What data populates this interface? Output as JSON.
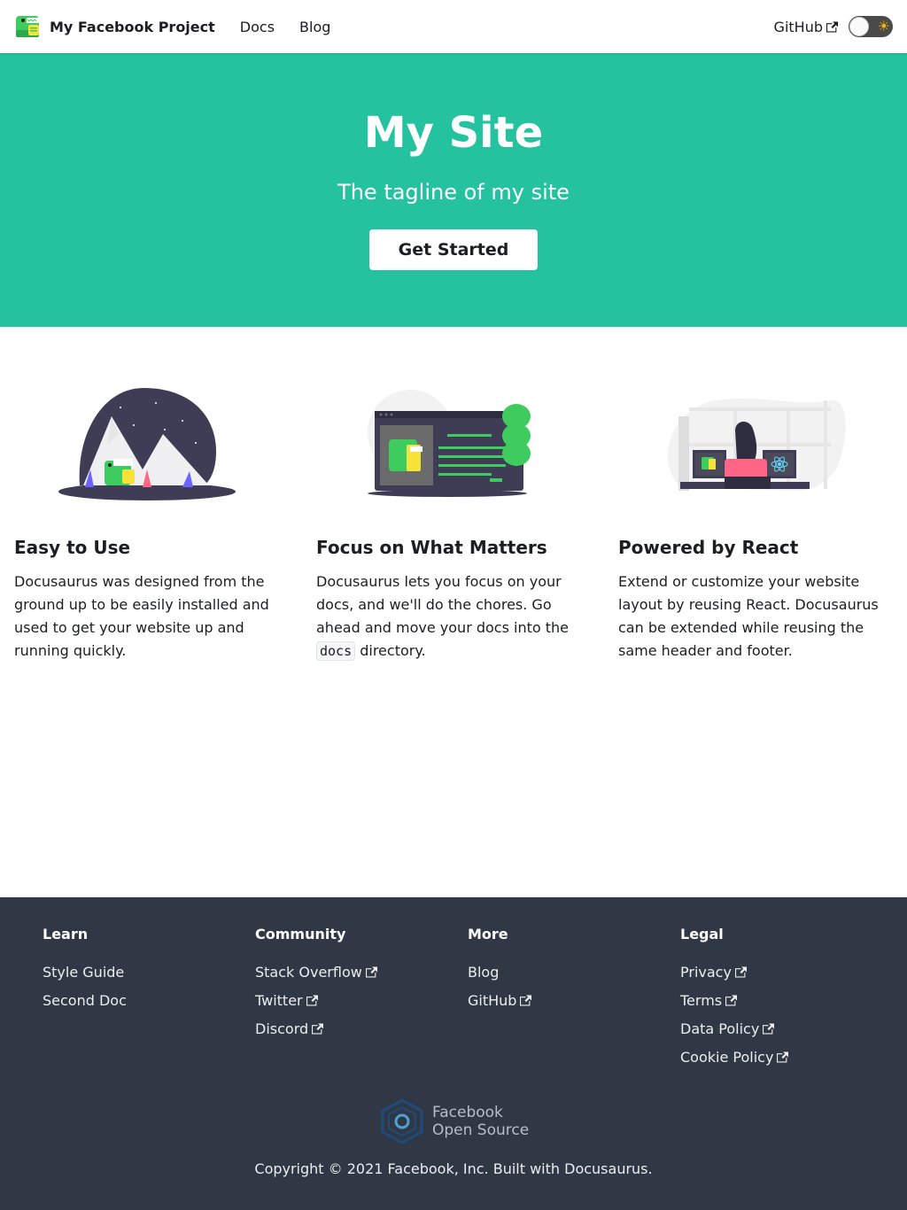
{
  "navbar": {
    "brand_title": "My Facebook Project",
    "links": [
      {
        "label": "Docs"
      },
      {
        "label": "Blog"
      }
    ],
    "github_label": "GitHub",
    "theme_toggle_icon": "sun-icon"
  },
  "hero": {
    "title": "My Site",
    "tagline": "The tagline of my site",
    "button_label": "Get Started"
  },
  "features": [
    {
      "title": "Easy to Use",
      "text": "Docusaurus was designed from the ground up to be easily installed and used to get your website up and running quickly.",
      "image": "mountain-dinosaur-illustration"
    },
    {
      "title": "Focus on What Matters",
      "text_before": "Docusaurus lets you focus on your docs, and we'll do the chores. Go ahead and move your docs into the",
      "code": "docs",
      "text_after": "directory.",
      "image": "tree-screen-illustration"
    },
    {
      "title": "Powered by React",
      "text": "Extend or customize your website layout by reusing React. Docusaurus can be extended while reusing the same header and footer.",
      "image": "react-desk-illustration"
    }
  ],
  "footer": {
    "columns": [
      {
        "title": "Learn",
        "links": [
          {
            "label": "Style Guide"
          },
          {
            "label": "Second Doc"
          }
        ]
      },
      {
        "title": "Community",
        "links": [
          {
            "label": "Stack Overflow"
          },
          {
            "label": "Twitter"
          },
          {
            "label": "Discord"
          }
        ]
      },
      {
        "title": "More",
        "links": [
          {
            "label": "Blog"
          },
          {
            "label": "GitHub"
          }
        ]
      },
      {
        "title": "Legal",
        "links": [
          {
            "label": "Privacy"
          },
          {
            "label": "Terms"
          },
          {
            "label": "Data Policy"
          },
          {
            "label": "Cookie Policy"
          }
        ]
      }
    ],
    "fb_open_source_line1": "Facebook",
    "fb_open_source_line2": "Open Source",
    "copyright": "Copyright © 2021 Facebook, Inc. Built with Docusaurus."
  },
  "colors": {
    "primary": "#25c2a0",
    "footer_bg": "#303846",
    "text": "#1c1e21"
  }
}
